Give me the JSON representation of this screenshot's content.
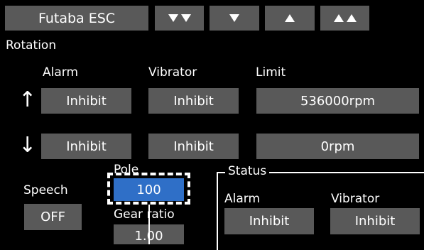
{
  "header": {
    "title": "Futaba ESC",
    "nav": {
      "page_down_icon": "double-down-triangle",
      "down_icon": "down-triangle",
      "up_icon": "up-triangle",
      "page_up_icon": "double-up-triangle"
    }
  },
  "section_title": "Rotation",
  "columns": {
    "alarm": "Alarm",
    "vibrator": "Vibrator",
    "limit": "Limit"
  },
  "arrows": {
    "up": "↑",
    "down": "↓"
  },
  "rows": {
    "up": {
      "alarm": "Inhibit",
      "vibrator": "Inhibit",
      "limit": "536000rpm"
    },
    "down": {
      "alarm": "Inhibit",
      "vibrator": "Inhibit",
      "limit": "0rpm"
    }
  },
  "speech": {
    "label": "Speech",
    "value": "OFF"
  },
  "pole": {
    "label": "Pole",
    "value": "100"
  },
  "gear_ratio": {
    "label": "Gear ratio",
    "value": "1.00"
  },
  "status": {
    "title": "Status",
    "alarm_label": "Alarm",
    "vibrator_label": "Vibrator",
    "alarm_value": "Inhibit",
    "vibrator_value": "Inhibit"
  },
  "colors": {
    "background": "#000000",
    "button": "#595959",
    "selected": "#2f6fc7",
    "highlight_border": "#ffffff"
  }
}
